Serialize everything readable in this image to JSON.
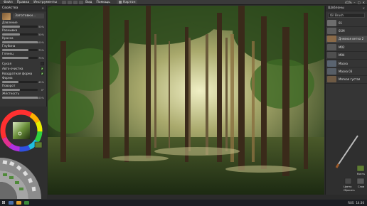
{
  "menu": {
    "items": [
      "Файл",
      "Правка",
      "Инструменты",
      "Вид",
      "Помощь"
    ],
    "canvas_tab": "Картон",
    "zoom": "41%"
  },
  "left_panel": {
    "title": "Свойства",
    "brush_name": "Заготовки...",
    "properties": [
      {
        "label": "Давление",
        "value": "50%",
        "fill": 0.5
      },
      {
        "label": "Размывка",
        "value": "50%",
        "fill": 0.5
      },
      {
        "label": "Краска",
        "value": "100%",
        "fill": 1.0
      },
      {
        "label": "Глубина",
        "value": "73%",
        "fill": 0.73
      },
      {
        "label": "Глянец",
        "value": "73%",
        "fill": 0.73
      }
    ],
    "checkboxes": [
      {
        "label": "Сухая",
        "checked": false
      },
      {
        "label": "Авто-очистка",
        "checked": true
      },
      {
        "label": "Квадратная форма",
        "checked": true
      }
    ],
    "properties2": [
      {
        "label": "Форма",
        "value": "45%",
        "fill": 0.45
      },
      {
        "label": "Поворот",
        "value": "0°",
        "fill": 0.5
      },
      {
        "label": "Жёсткость",
        "value": "100%",
        "fill": 1.0
      }
    ]
  },
  "right_panel": {
    "title": "Шаблоны",
    "search_value": "Oil Brush",
    "presets": [
      {
        "name": "01",
        "color": "#6d6d6d"
      },
      {
        "name": "01М",
        "color": "#5d5d5d"
      },
      {
        "name": "Дневная ветка 2",
        "color": "#8a6a48"
      },
      {
        "name": "М02",
        "color": "#585858"
      },
      {
        "name": "М04",
        "color": "#4f4f4f"
      },
      {
        "name": "Маска",
        "color": "#5a6470"
      },
      {
        "name": "Маска 03",
        "color": "#575e66"
      },
      {
        "name": "Мягкая густая",
        "color": "#6e5a44"
      }
    ],
    "tool_labels": [
      "Кисть",
      "Цвета",
      "Сбросить",
      "Слои"
    ]
  },
  "taskbar": {
    "time": "14:36",
    "lang": "RUS"
  }
}
